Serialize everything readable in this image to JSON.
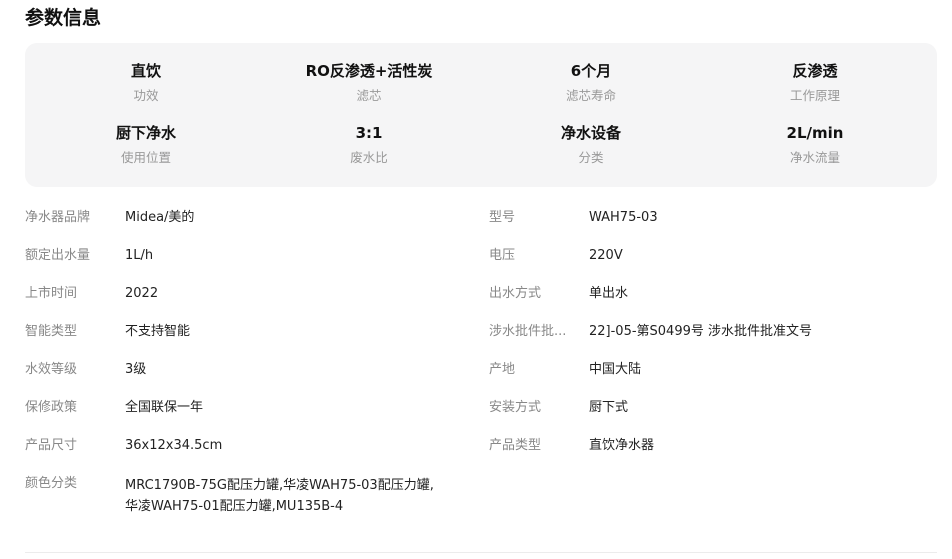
{
  "section": {
    "title": "参数信息"
  },
  "highlights": [
    {
      "value": "直饮",
      "label": "功效"
    },
    {
      "value": "RO反渗透+活性炭",
      "label": "滤芯"
    },
    {
      "value": "6个月",
      "label": "滤芯寿命"
    },
    {
      "value": "反渗透",
      "label": "工作原理"
    },
    {
      "value": "厨下净水",
      "label": "使用位置"
    },
    {
      "value": "3:1",
      "label": "废水比"
    },
    {
      "value": "净水设备",
      "label": "分类"
    },
    {
      "value": "2L/min",
      "label": "净水流量"
    }
  ],
  "specs_left": [
    {
      "label": "净水器品牌",
      "value": "Midea/美的"
    },
    {
      "label": "额定出水量",
      "value": "1L/h"
    },
    {
      "label": "上市时间",
      "value": "2022"
    },
    {
      "label": "智能类型",
      "value": "不支持智能"
    },
    {
      "label": "水效等级",
      "value": "3级"
    },
    {
      "label": "保修政策",
      "value": "全国联保一年"
    },
    {
      "label": "产品尺寸",
      "value": "36x12x34.5cm"
    },
    {
      "label": "颜色分类",
      "value": "MRC1790B-75G配压力罐,华凌WAH75-03配压力罐,华凌WAH75-01配压力罐,MU135B-4"
    }
  ],
  "specs_right": [
    {
      "label": "型号",
      "value": "WAH75-03"
    },
    {
      "label": "电压",
      "value": "220V"
    },
    {
      "label": "出水方式",
      "value": "单出水"
    },
    {
      "label": "涉水批件批...",
      "value": "22]-05-第S0499号 涉水批件批准文号"
    },
    {
      "label": "产地",
      "value": "中国大陆"
    },
    {
      "label": "安装方式",
      "value": "厨下式"
    },
    {
      "label": "产品类型",
      "value": "直饮净水器"
    }
  ]
}
